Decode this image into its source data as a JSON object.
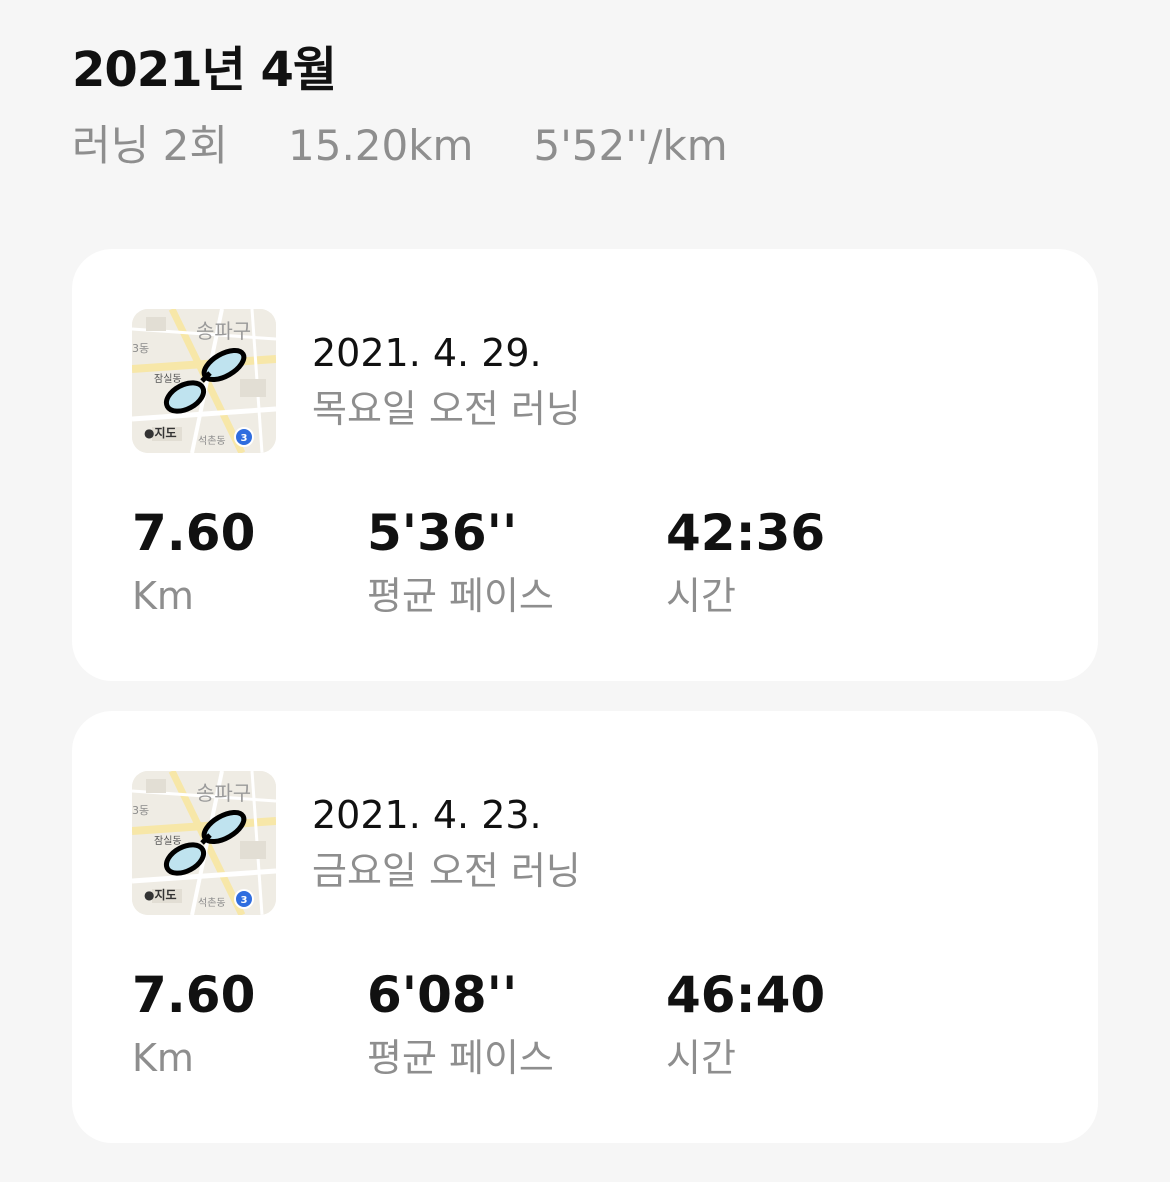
{
  "month": {
    "title": "2021년 4월",
    "runs_count": "러닝 2회",
    "total_distance": "15.20km",
    "avg_pace": "5'52''/km"
  },
  "map_thumb": {
    "district": "송파구",
    "label_a": "3동",
    "label_b": "잠실동",
    "label_c": "석촌동",
    "brand": "지도",
    "route_number": "3"
  },
  "runs": [
    {
      "date": "2021. 4. 29.",
      "name": "목요일 오전 러닝",
      "distance": "7.60",
      "distance_label": "Km",
      "pace": "5'36''",
      "pace_label": "평균 페이스",
      "time": "42:36",
      "time_label": "시간"
    },
    {
      "date": "2021. 4. 23.",
      "name": "금요일 오전 러닝",
      "distance": "7.60",
      "distance_label": "Km",
      "pace": "6'08''",
      "pace_label": "평균 페이스",
      "time": "46:40",
      "time_label": "시간"
    }
  ],
  "colors": {
    "background": "#f6f6f6",
    "card": "#ffffff",
    "secondary_text": "#8e8e8e",
    "route_badge": "#2f6ddf",
    "lake_fill": "#bfe3ef"
  }
}
